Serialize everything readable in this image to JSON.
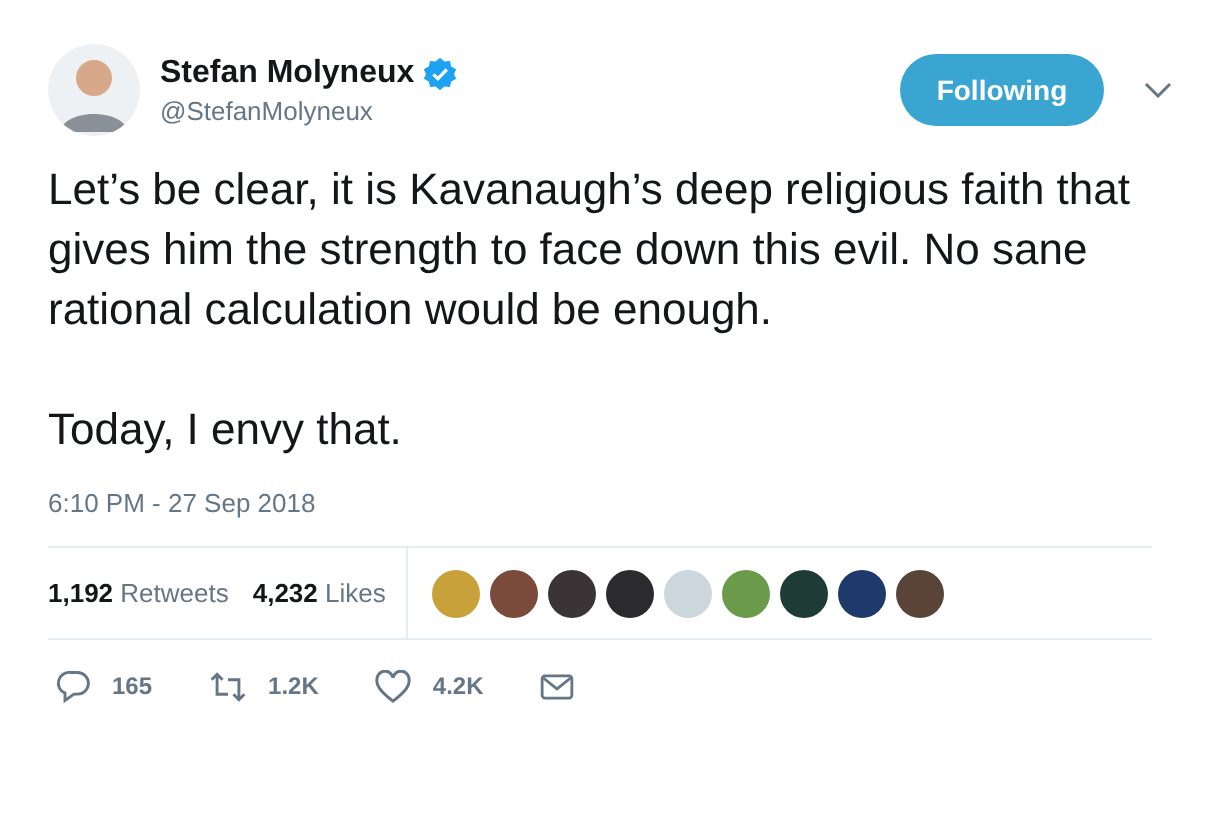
{
  "author": {
    "name": "Stefan Molyneux",
    "handle": "@StefanMolyneux",
    "verified": true
  },
  "follow_button": {
    "label": "Following",
    "following": true
  },
  "tweet": {
    "paragraphs": [
      "Let’s be clear, it is Kavanaugh’s deep religious faith that gives him the strength to face down this evil. No sane rational calculation would be enough.",
      "Today, I envy that."
    ],
    "timestamp": "6:10 PM - 27 Sep 2018"
  },
  "stats": [
    {
      "count": "1,192",
      "label": "Retweets"
    },
    {
      "count": "4,232",
      "label": "Likes"
    }
  ],
  "likers": [
    {
      "color": "#c9a13a"
    },
    {
      "color": "#7a4a3a"
    },
    {
      "color": "#3a3436"
    },
    {
      "color": "#2b2b2e"
    },
    {
      "color": "#ccd6dd"
    },
    {
      "color": "#6a9a4a"
    },
    {
      "color": "#1f3b36"
    },
    {
      "color": "#1d3a6a"
    },
    {
      "color": "#5a4438"
    }
  ],
  "actions": [
    {
      "kind": "reply",
      "count": "165"
    },
    {
      "kind": "retweet",
      "count": "1.2K"
    },
    {
      "kind": "like",
      "count": "4.2K"
    },
    {
      "kind": "message"
    }
  ]
}
